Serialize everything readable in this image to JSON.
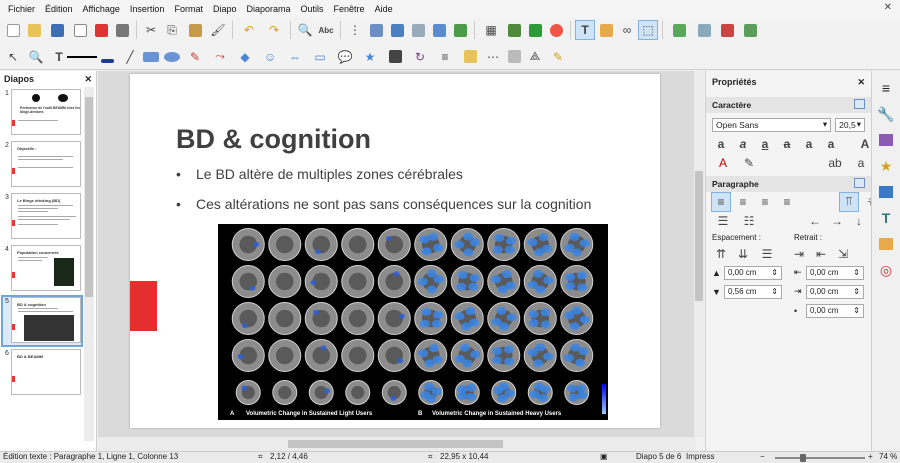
{
  "menu": [
    "Fichier",
    "Édition",
    "Affichage",
    "Insertion",
    "Format",
    "Diapo",
    "Diaporama",
    "Outils",
    "Fenêtre",
    "Aide"
  ],
  "slides_panel": {
    "title": "Diapos",
    "slides": [
      {
        "num": "1",
        "title": "Pertinence de l'outil BEAMM chez les binge-drinkers"
      },
      {
        "num": "2",
        "title": "Objectifs :"
      },
      {
        "num": "3",
        "title": "Le Binge drinking (BD)"
      },
      {
        "num": "4",
        "title": "Population concernée"
      },
      {
        "num": "5",
        "title": "BD & cognition"
      },
      {
        "num": "6",
        "title": "BD & BEAMM"
      }
    ],
    "selected_index": 4
  },
  "slide": {
    "title": "BD & cognition",
    "bullets": [
      "Le BD altère de multiples zones cérébrales",
      "Ces altérations ne sont pas sans conséquences sur la cognition"
    ],
    "figure": {
      "caption_a_letter": "A",
      "caption_a": "Volumetric Change in Sustained Light Users",
      "caption_b_letter": "B",
      "caption_b": "Volumetric Change in Sustained Heavy Users"
    }
  },
  "properties": {
    "title": "Propriétés",
    "character_section": "Caractère",
    "font_name": "Open Sans",
    "font_size": "20,5",
    "paragraph_section": "Paragraphe",
    "spacing_label": "Espacement :",
    "indent_label": "Retrait :",
    "spacing_above": "0,00 cm",
    "spacing_below": "0,56 cm",
    "indent_before": "0,00 cm",
    "indent_after": "0,00 cm",
    "indent_first": "0,00 cm"
  },
  "status": {
    "edit_text": "Édition texte : Paragraphe 1, Ligne 1, Colonne 13",
    "position": "2,12 / 4,46",
    "size": "22,95 x 10,44",
    "slide_of": "Diapo 5 de 6",
    "mode": "Impress",
    "zoom": "74 %"
  }
}
